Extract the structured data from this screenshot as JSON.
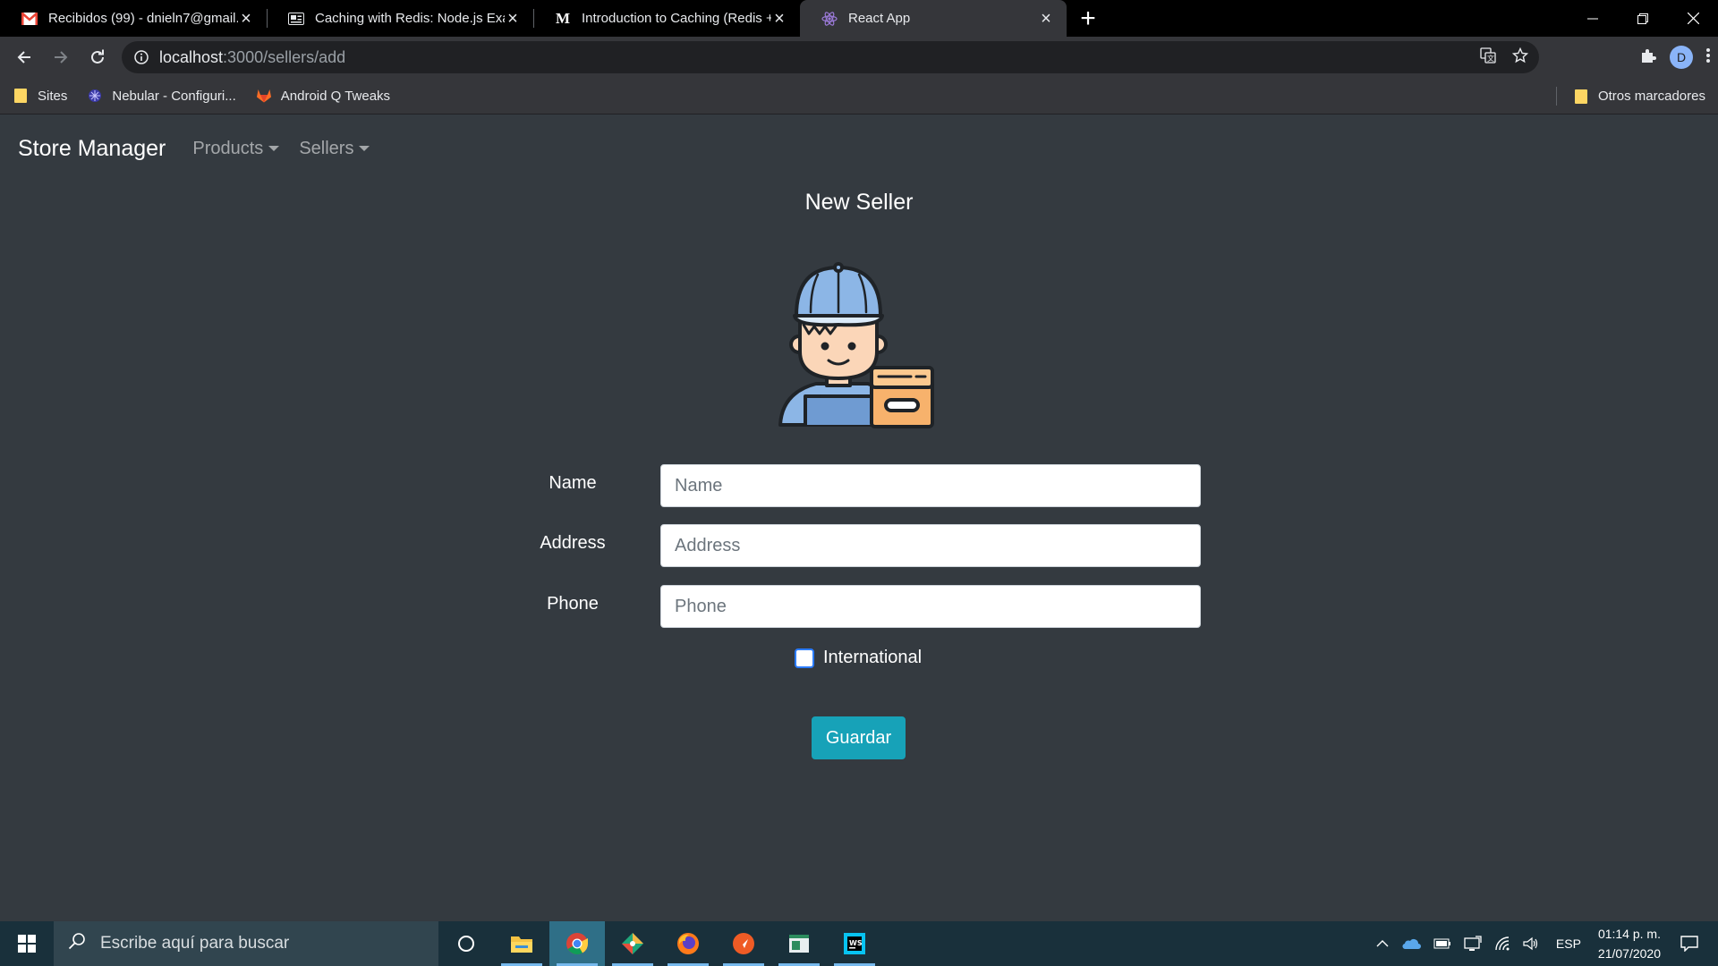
{
  "browser": {
    "tabs": [
      {
        "title": "Recibidos (99) - dnieln7@gmail.com",
        "icon": "gmail-icon",
        "active": false
      },
      {
        "title": "Caching with Redis: Node.js Example",
        "icon": "article-icon",
        "active": false
      },
      {
        "title": "Introduction to Caching (Redis + Node.js)",
        "icon": "medium-icon",
        "active": false
      },
      {
        "title": "React App",
        "icon": "react-icon",
        "active": true
      }
    ],
    "address": {
      "host": "localhost",
      "path": ":3000/sellers/add"
    },
    "profile_initial": "D",
    "bookmarks": [
      {
        "label": "Sites",
        "icon": "folder-icon"
      },
      {
        "label": "Nebular - Configuri...",
        "icon": "nebular-icon"
      },
      {
        "label": "Android Q Tweaks",
        "icon": "gitlab-icon"
      }
    ],
    "other_bookmarks": "Otros marcadores"
  },
  "app": {
    "brand": "Store Manager",
    "nav": [
      {
        "label": "Products"
      },
      {
        "label": "Sellers"
      }
    ],
    "page_title": "New Seller",
    "illustration": "delivery-man-with-box",
    "form": {
      "name": {
        "label": "Name",
        "placeholder": "Name",
        "value": ""
      },
      "address": {
        "label": "Address",
        "placeholder": "Address",
        "value": ""
      },
      "phone": {
        "label": "Phone",
        "placeholder": "Phone",
        "value": ""
      },
      "international": {
        "label": "International",
        "checked": false
      },
      "submit": "Guardar"
    }
  },
  "taskbar": {
    "search_placeholder": "Escribe aquí para buscar",
    "language": "ESP",
    "time": "01:14 p. m.",
    "date": "21/07/2020"
  },
  "colors": {
    "app_background": "#343a40",
    "button_info": "#17a2b8",
    "taskbar": "#19303b"
  }
}
